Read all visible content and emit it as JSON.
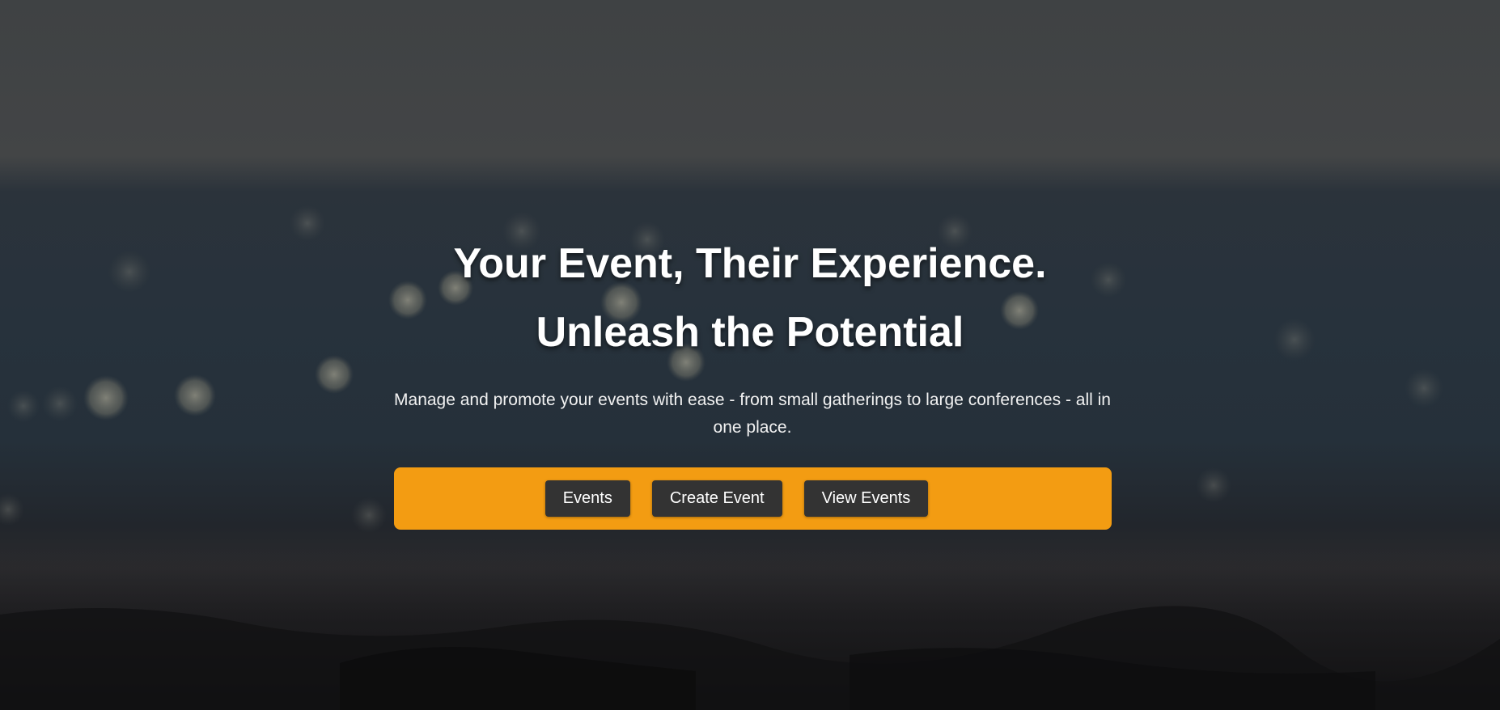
{
  "hero": {
    "title_line_1": "Your Event, Their Experience.",
    "title_line_2": "Unleash the Potential",
    "subtitle": "Manage and promote your events with ease - from small gatherings to large conferences - all in one place."
  },
  "actions": {
    "events_label": "Events",
    "create_event_label": "Create Event",
    "view_events_label": "View Events"
  },
  "colors": {
    "action_bar": "#f39c12",
    "button_bg": "#333333",
    "text": "#ffffff"
  }
}
